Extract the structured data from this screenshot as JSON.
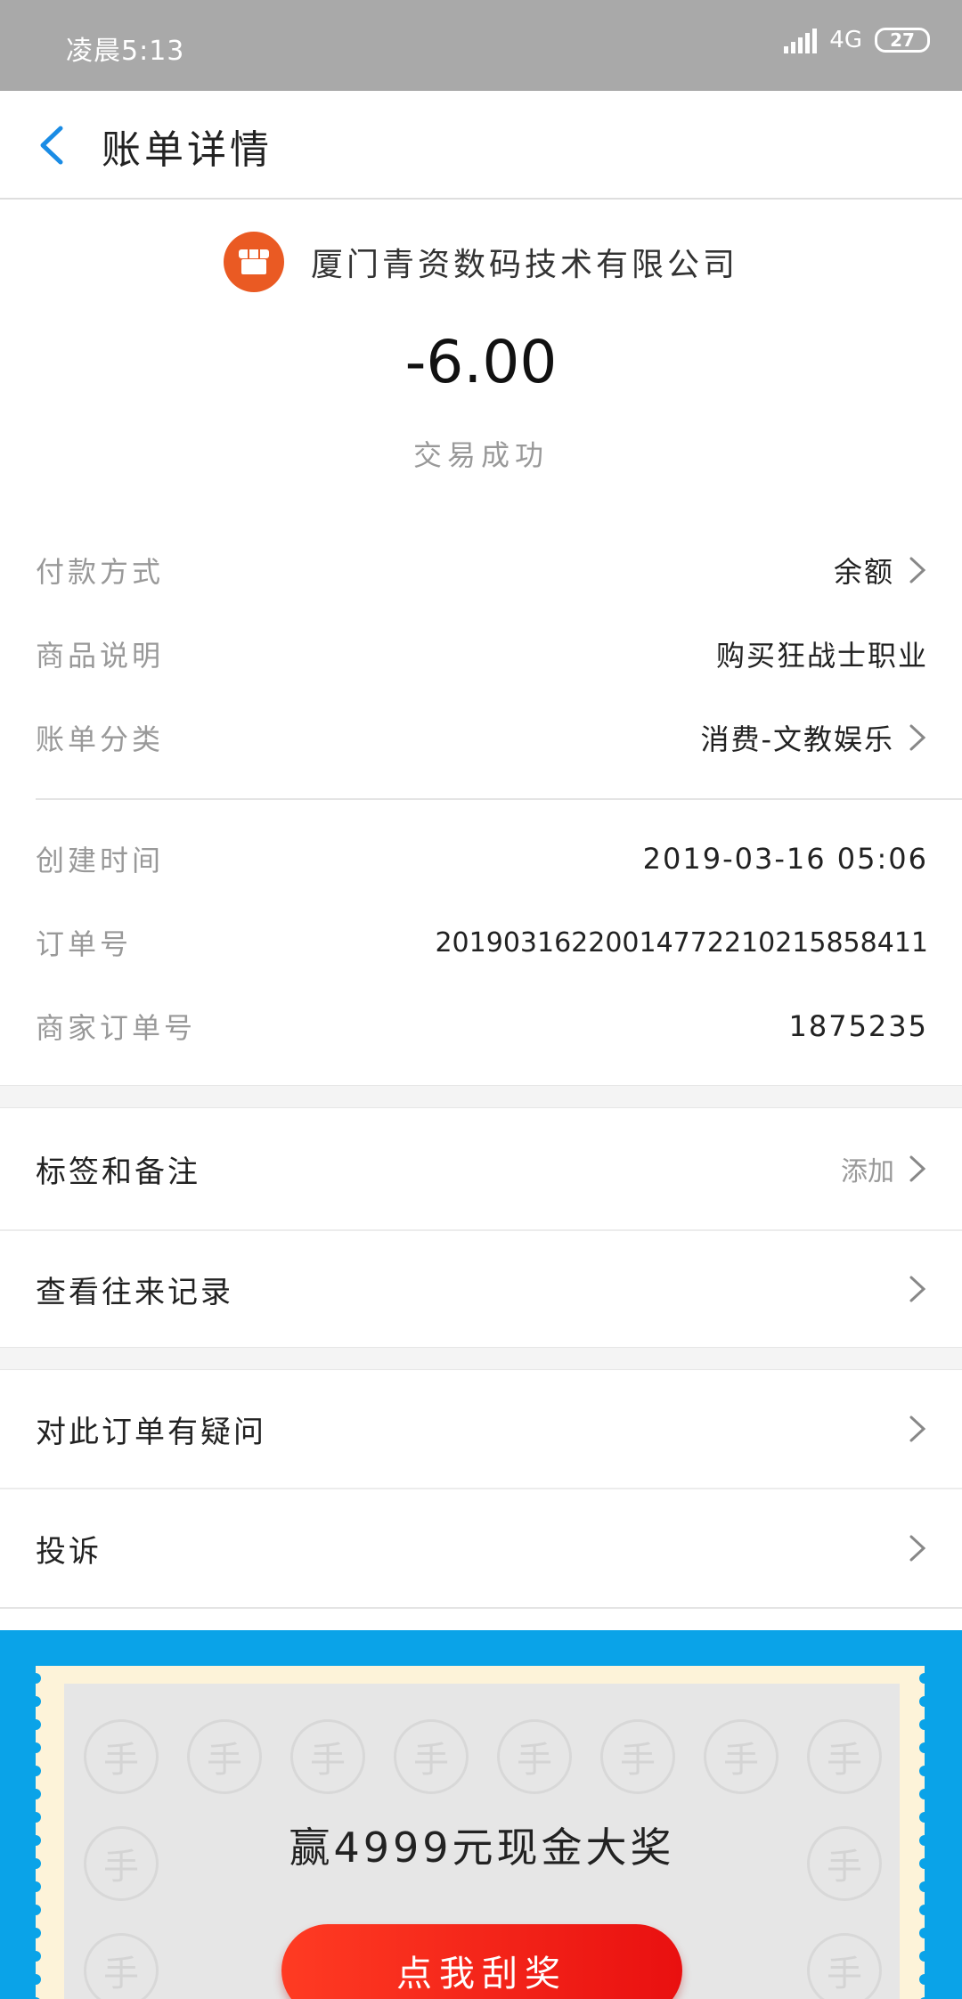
{
  "status_bar": {
    "time": "凌晨5:13",
    "network": "4G",
    "battery": "27"
  },
  "header": {
    "title": "账单详情"
  },
  "summary": {
    "merchant": "厦门青资数码技术有限公司",
    "amount": "-6.00",
    "status": "交易成功"
  },
  "details": {
    "payment_method": {
      "label": "付款方式",
      "value": "余额"
    },
    "product": {
      "label": "商品说明",
      "value": "购买狂战士职业"
    },
    "category": {
      "label": "账单分类",
      "value": "消费-文教娱乐"
    },
    "created": {
      "label": "创建时间",
      "value": "2019-03-16 05:06"
    },
    "order_no": {
      "label": "订单号",
      "value": "20190316220014772210215858411"
    },
    "merchant_order_no": {
      "label": "商家订单号",
      "value": "1875235"
    }
  },
  "actions": {
    "tags": {
      "label": "标签和备注",
      "hint": "添加"
    },
    "history": {
      "label": "查看往来记录"
    },
    "question": {
      "label": "对此订单有疑问"
    },
    "complaint": {
      "label": "投诉"
    }
  },
  "promo": {
    "title": "赢4999元现金大奖",
    "button": "点我刮奖",
    "watermark": "手"
  },
  "colors": {
    "accent": "#1a8ce5",
    "promo_bg": "#0aa3e8",
    "button": "#ee1c14",
    "merchant_logo": "#ea5a23"
  }
}
